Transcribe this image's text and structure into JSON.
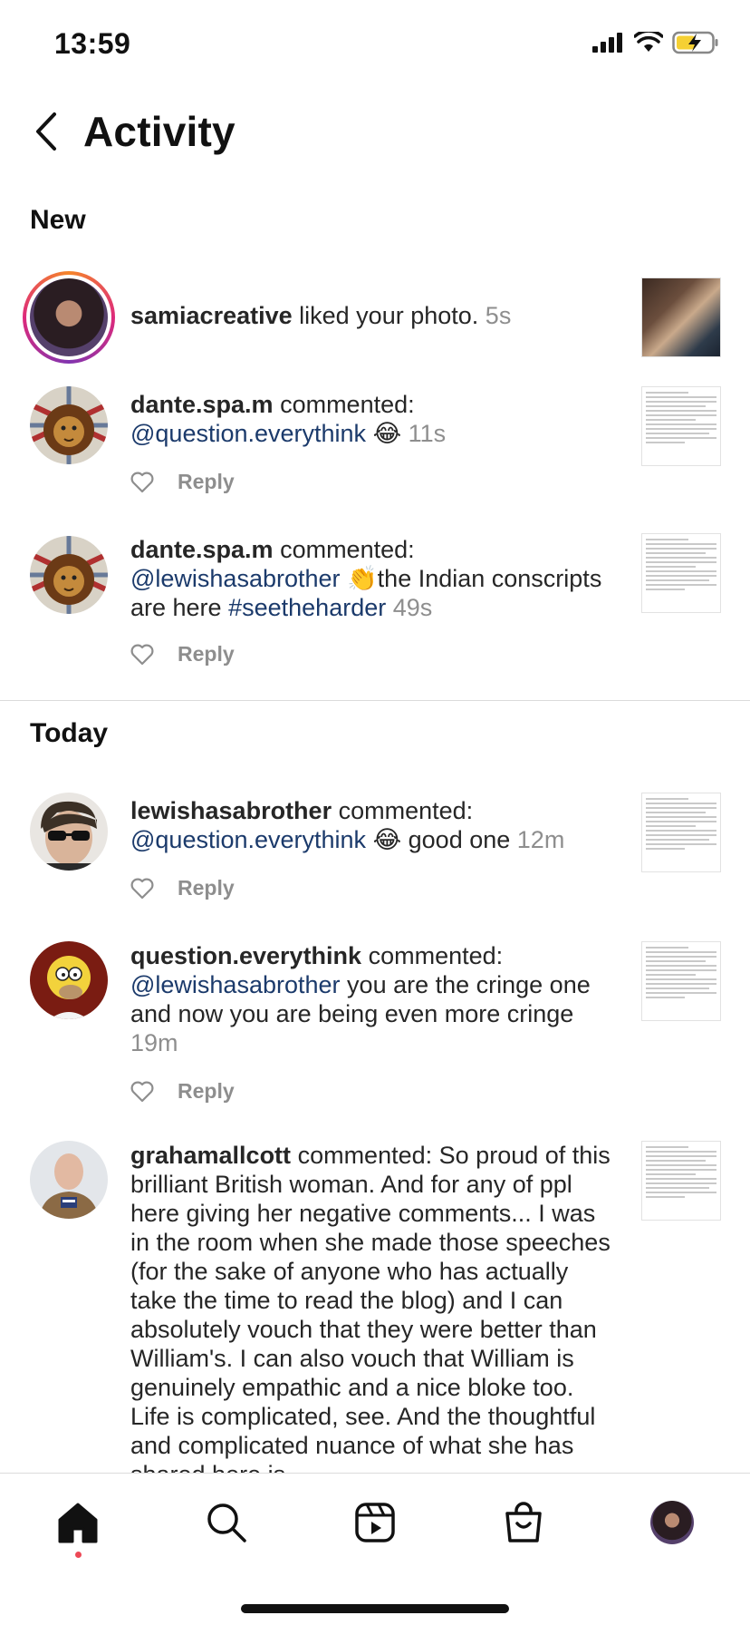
{
  "status_bar": {
    "time": "13:59"
  },
  "header": {
    "title": "Activity"
  },
  "sections": {
    "new": "New",
    "today": "Today"
  },
  "labels": {
    "reply": "Reply"
  },
  "notifications": [
    {
      "username": "samiacreative",
      "action": "liked your photo.",
      "time": "5s",
      "has_reply": false
    },
    {
      "username": "dante.spa.m",
      "action": "commented:",
      "mention": "@question.everythink",
      "emoji": "😂",
      "time": "11s",
      "has_reply": true
    },
    {
      "username": "dante.spa.m",
      "action": "commented:",
      "mention": "@lewishasabrother",
      "emoji": "👏",
      "text": "the Indian conscripts are here",
      "hashtag": "#seetheharder",
      "time": "49s",
      "has_reply": true
    },
    {
      "username": "lewishasabrother",
      "action": "commented:",
      "mention": "@question.everythink",
      "emoji": "😂",
      "text": "good one",
      "time": "12m",
      "has_reply": true
    },
    {
      "username": "question.everythink",
      "action": "commented:",
      "mention": "@lewishasabrother",
      "text": "you are the cringe one and now you are being even more cringe",
      "time": "19m",
      "has_reply": true
    },
    {
      "username": "grahamallcott",
      "action": "commented:",
      "text": "So proud of this brilliant British woman. And for any of ppl here giving her negative comments... I was in the room when she made those speeches (for the sake of anyone who has actually take the time to read the blog) and I can absolutely vouch that they were better than William's. I can also vouch that William is genuinely empathic and a nice bloke too. Life is complicated, see. And the thoughtful and complicated nuance of what she has shared here is"
    }
  ],
  "tabs": [
    "home",
    "search",
    "reels",
    "shop",
    "profile"
  ],
  "colors": {
    "link": "#1b3a6b",
    "muted": "#8e8e8e",
    "notification_dot": "#ed4956"
  }
}
